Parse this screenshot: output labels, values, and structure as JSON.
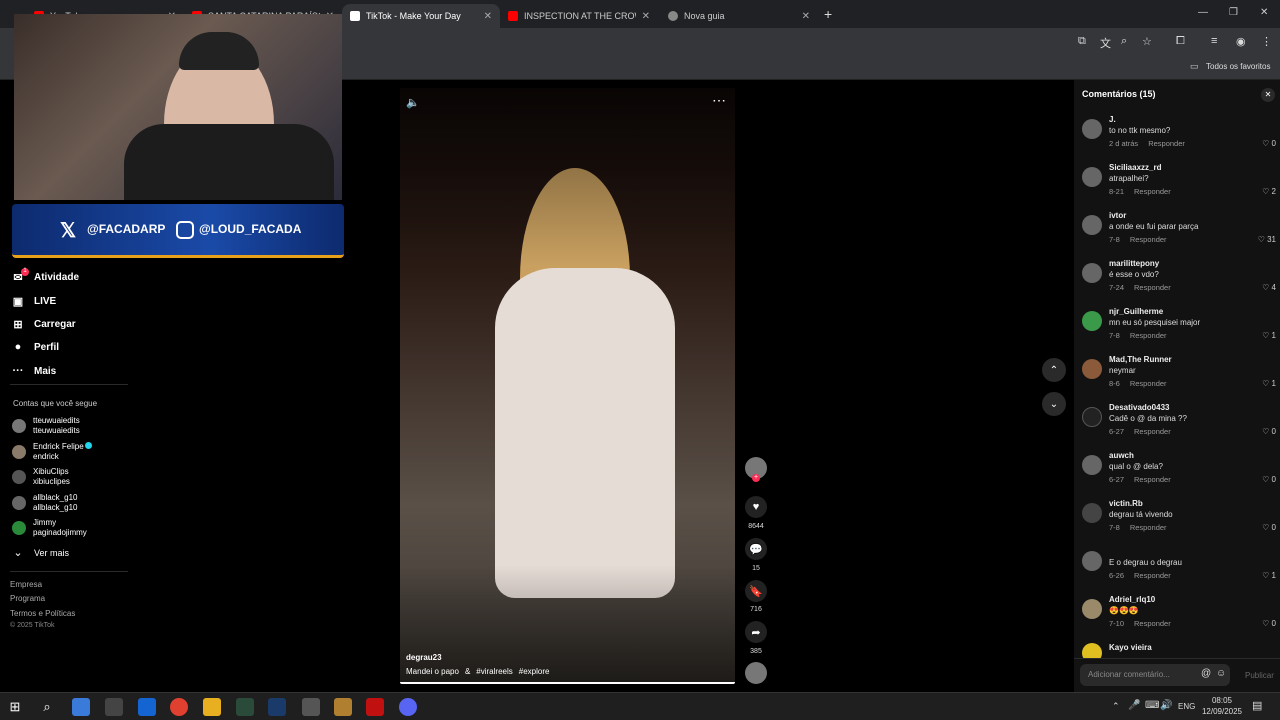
{
  "browser": {
    "tabs": [
      {
        "label": "YouTube",
        "color": "#ff0000"
      },
      {
        "label": "SANTA CATARINA PARAÍSO DA",
        "color": "#ff0000"
      },
      {
        "label": "TikTok - Make Your Day",
        "color": "#ffffff"
      },
      {
        "label": "INSPECTION AT THE CROWDED",
        "color": "#ff0000"
      },
      {
        "label": "Nova guia",
        "color": "#888888"
      }
    ],
    "bookmarks_label": "Todos os favoritos"
  },
  "sidebar": {
    "nav": [
      {
        "label": "Atividade",
        "icon": "bell-icon"
      },
      {
        "label": "LIVE",
        "icon": "live-icon"
      },
      {
        "label": "Carregar",
        "icon": "upload-icon"
      },
      {
        "label": "Perfil",
        "icon": "profile-icon"
      },
      {
        "label": "Mais",
        "icon": "more-icon"
      }
    ],
    "following_title": "Contas que você segue",
    "following": [
      {
        "name": "tteuwuaiedits",
        "handle": "tteuwuaiedits"
      },
      {
        "name": "Endrick Felipe",
        "handle": "endrick"
      },
      {
        "name": "XibiuClips",
        "handle": "xibiuclipes"
      },
      {
        "name": "allblack_g10",
        "handle": "allblack_g10"
      },
      {
        "name": "Jimmy",
        "handle": "paginadojimmy"
      }
    ],
    "see_more": "Ver mais",
    "footer": [
      "Empresa",
      "Programa",
      "Termos e Políticas",
      "© 2025 TikTok"
    ]
  },
  "overlay": {
    "x_handle": "@FACADARP",
    "ig_handle": "@LOUD_FACADA"
  },
  "video": {
    "author": "degrau23",
    "caption": "Mandei o papo",
    "tags": [
      "#viralreels",
      "#explore"
    ],
    "likes": "8644",
    "comments": "15",
    "saves": "716",
    "shares": "385"
  },
  "comments": {
    "title": "Comentários (15)",
    "reply_label": "Responder",
    "input_placeholder": "Adicionar comentário...",
    "publish_label": "Publicar",
    "items": [
      {
        "user": "J.",
        "text": "to no ttk mesmo?",
        "date": "2 d atrás",
        "likes": "0"
      },
      {
        "user": "Siciliaaxzz_rd",
        "text": "atrapalhei?",
        "date": "8-21",
        "likes": "2"
      },
      {
        "user": "ivtor",
        "text": "a onde eu fui parar parça",
        "date": "7-8",
        "likes": "31"
      },
      {
        "user": "marilittepony",
        "text": "é esse o vdo?",
        "date": "7-24",
        "likes": "4"
      },
      {
        "user": "njr_Guilherme",
        "text": "mn eu só pesquisei major",
        "date": "7-8",
        "likes": "1"
      },
      {
        "user": "Mad,The Runner",
        "text": "neymar",
        "date": "8-6",
        "likes": "1"
      },
      {
        "user": "Desativado0433",
        "text": "Cadê o @ da mina ??",
        "date": "6-27",
        "likes": "0"
      },
      {
        "user": "auwch",
        "text": "qual o @ dela?",
        "date": "6-27",
        "likes": "0"
      },
      {
        "user": "victin.Rb",
        "text": "degrau tá vivendo",
        "date": "7-8",
        "likes": "0"
      },
      {
        "user": "",
        "text": "E o degrau o degrau",
        "date": "6-26",
        "likes": "1"
      },
      {
        "user": "Adriel_rlq10",
        "text": "😍😍😍",
        "date": "7-10",
        "likes": "0"
      },
      {
        "user": "Kayo vieira",
        "text": "",
        "date": "",
        "likes": ""
      }
    ]
  },
  "taskbar": {
    "lang": "ENG",
    "time": "08:05",
    "date": "12/09/2025"
  }
}
